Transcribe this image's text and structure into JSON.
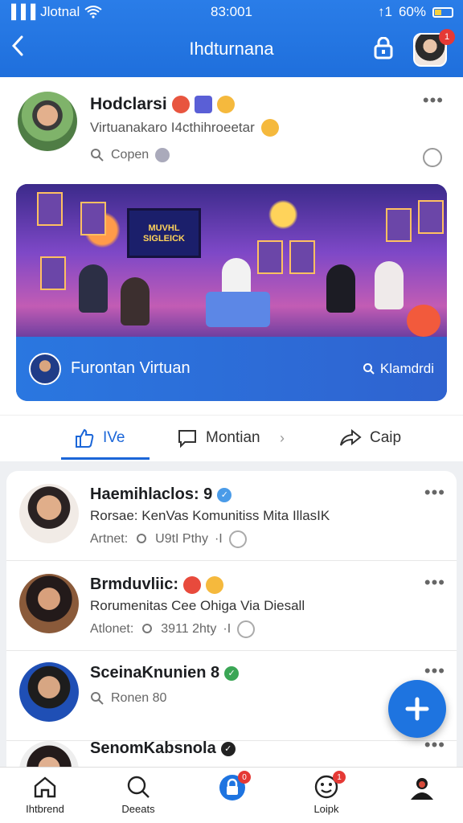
{
  "status_bar": {
    "carrier": "Jlotnal",
    "time": "83:001",
    "network": "↑1",
    "battery": "60%"
  },
  "header": {
    "title": "Ihdturnana",
    "back_icon": "back-arrow-icon",
    "lock_icon": "lock-icon",
    "notification_count": "1"
  },
  "post": {
    "author": "Hodclarsi",
    "subtitle": "Virtuanakaro I4cthihroeetar",
    "open_label": "Copen",
    "banner": {
      "screen_text": "MUVHL SIGLEICK",
      "title": "Furontan Virtuan",
      "action": "Klamdrdi"
    },
    "actions": {
      "like": "IVe",
      "comment": "Montian",
      "share": "Caip"
    }
  },
  "list": [
    {
      "name": "Haemihlaclos: 9",
      "desc": "Rorsae: KenVas Komunitiss Mita IllasIK",
      "meta_label": "Artnet:",
      "meta_value": "U9tI Pthy",
      "meta_sep": "·I"
    },
    {
      "name": "Brmduvliic:",
      "desc": "Rorumenitas Cee Ohiga Via Diesall",
      "meta_label": "Atlonet:",
      "meta_value": "3911 2hty",
      "meta_sep": "·I"
    },
    {
      "name": "SceinaKnunien 8",
      "meta_value": "Ronen 80"
    },
    {
      "name": "SenomKabsnola"
    }
  ],
  "bottom_nav": [
    {
      "label": "Ihtbrend",
      "icon": "home-icon"
    },
    {
      "label": "Deeats",
      "icon": "search-icon"
    },
    {
      "label": "",
      "icon": "lock-icon",
      "badge": "0"
    },
    {
      "label": "Loipk",
      "icon": "smile-icon",
      "badge": "1"
    },
    {
      "label": "",
      "icon": "profile-icon"
    }
  ],
  "colors": {
    "primary": "#1f6fdc",
    "badge": "#e53935",
    "like": "#1b66d8"
  }
}
